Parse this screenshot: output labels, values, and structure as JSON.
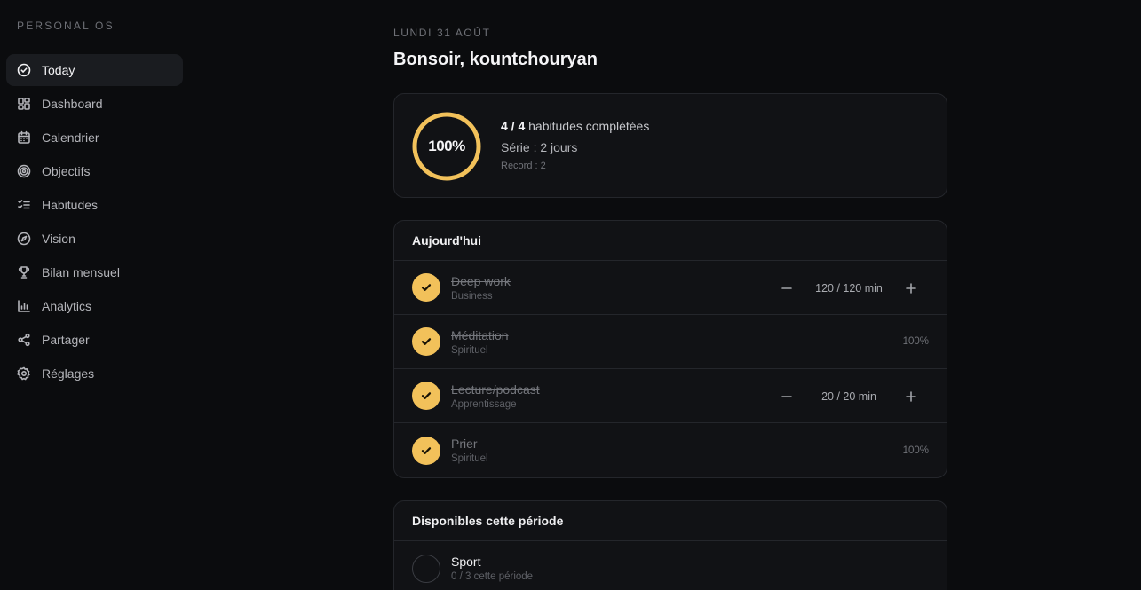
{
  "sidebar": {
    "brand": "PERSONAL OS",
    "items": [
      {
        "label": "Today",
        "icon": "check-circle-icon"
      },
      {
        "label": "Dashboard",
        "icon": "grid-icon"
      },
      {
        "label": "Calendrier",
        "icon": "calendar-icon"
      },
      {
        "label": "Objectifs",
        "icon": "target-icon"
      },
      {
        "label": "Habitudes",
        "icon": "checklist-icon"
      },
      {
        "label": "Vision",
        "icon": "compass-icon"
      },
      {
        "label": "Bilan mensuel",
        "icon": "trophy-icon"
      },
      {
        "label": "Analytics",
        "icon": "bar-chart-icon"
      },
      {
        "label": "Partager",
        "icon": "share-icon"
      },
      {
        "label": "Réglages",
        "icon": "settings-icon"
      }
    ]
  },
  "header": {
    "date": "LUNDI 31 AOÛT",
    "greeting": "Bonsoir, kountchouryan"
  },
  "summary": {
    "percent_label": "100%",
    "progress": 1.0,
    "completed": "4 / 4",
    "completed_suffix": " habitudes complétées",
    "streak": "Série : 2 jours",
    "record": "Record : 2",
    "accent_color": "#f2c15a"
  },
  "today": {
    "title": "Aujourd'hui",
    "habits": [
      {
        "name": "Deep work",
        "category": "Business",
        "value": "120 / 120 min"
      },
      {
        "name": "Méditation",
        "category": "Spirituel",
        "percent": "100%"
      },
      {
        "name": "Lecture/podcast",
        "category": "Apprentissage",
        "value": "20 / 20 min"
      },
      {
        "name": "Prier",
        "category": "Spirituel",
        "percent": "100%"
      }
    ]
  },
  "available": {
    "title": "Disponibles cette période",
    "habits": [
      {
        "name": "Sport",
        "progress": "0 / 3 cette période"
      }
    ]
  }
}
